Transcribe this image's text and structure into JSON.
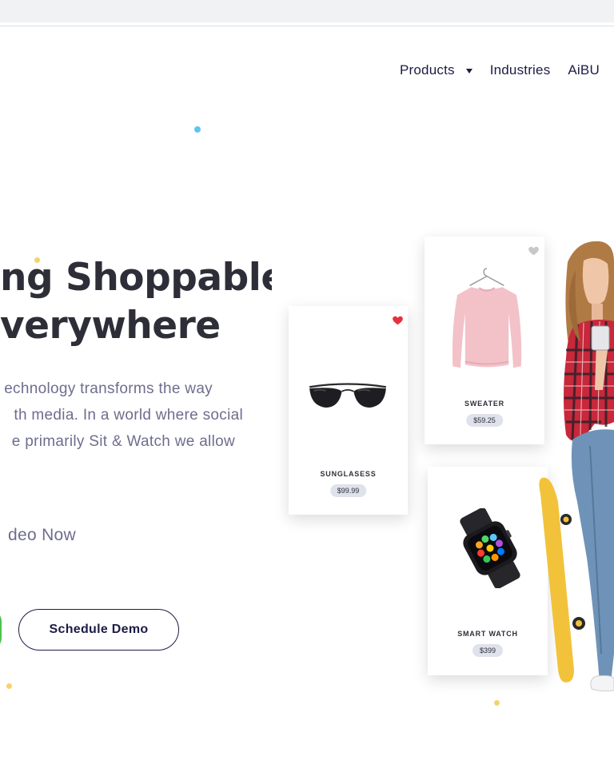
{
  "nav": {
    "items": [
      {
        "label": "Products",
        "has_dropdown": true
      },
      {
        "label": "Industries",
        "has_dropdown": false
      },
      {
        "label": "AiBU",
        "has_dropdown": false
      }
    ]
  },
  "hero": {
    "title_lines": [
      "ng Shoppable",
      "verywhere"
    ],
    "description_lines": [
      "echnology transforms the way",
      "th media. In a world where social",
      "e primarily Sit & Watch we allow"
    ],
    "watch_video_label": "deo Now",
    "schedule_demo_label": "Schedule Demo"
  },
  "products": [
    {
      "name": "SUNGLASESS",
      "price": "$99.99",
      "favorited": true,
      "icon": "sunglasses-icon"
    },
    {
      "name": "SWEATER",
      "price": "$59.25",
      "favorited": false,
      "icon": "sweater-icon"
    },
    {
      "name": "SMART WATCH",
      "price": "$399",
      "favorited": false,
      "icon": "smartwatch-icon"
    }
  ],
  "colors": {
    "nav_text": "#1c1c45",
    "title": "#2e2e38",
    "body_text": "#6e6d8f",
    "heart_active": "#e8303a",
    "heart_inactive": "#c8c8c8",
    "accent_green": "#4cc14f"
  }
}
